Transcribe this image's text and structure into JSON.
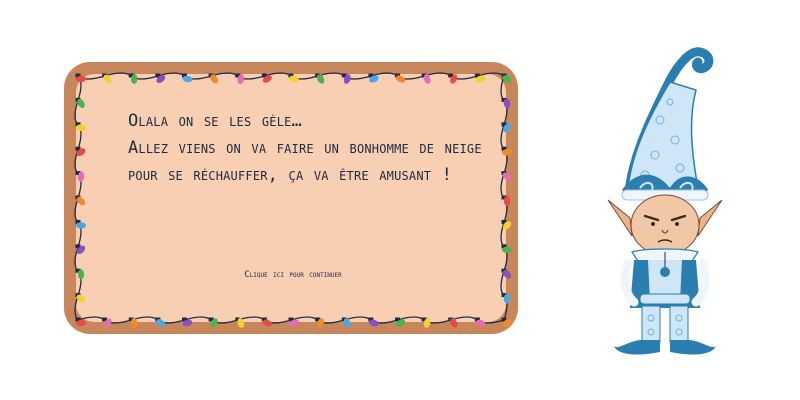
{
  "dialogue": {
    "line1": "Olala on se les gèle…",
    "line2": "Allez viens on va faire un bonhomme de neige",
    "line3": "pour se réchauffer, ça va être amusant !"
  },
  "continue_label": "Clique ici pour continuer",
  "colors": {
    "card_border": "#c8875a",
    "card_fill": "#f8cfb2",
    "text": "#1f2a44",
    "elf_blue": "#2a7fb0",
    "elf_light": "#cfe6f7"
  },
  "light_colors": [
    "#e64a4a",
    "#f2d22b",
    "#4bb34b",
    "#8a4fc2",
    "#4aa8e6",
    "#f28a2b",
    "#e66ab5"
  ]
}
